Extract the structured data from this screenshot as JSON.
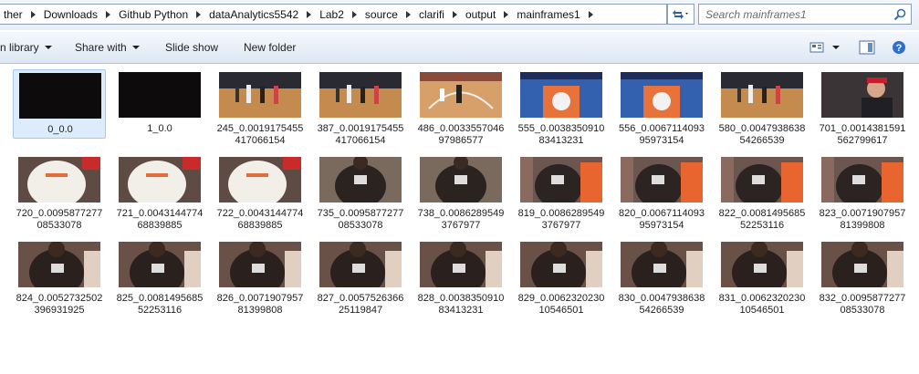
{
  "address": {
    "crumbs": [
      "ther",
      "Downloads",
      "Github Python",
      "dataAnalytics5542",
      "Lab2",
      "source",
      "clarifi",
      "output",
      "mainframes1"
    ]
  },
  "search": {
    "placeholder": "Search mainframes1"
  },
  "toolbar": {
    "include_label": "n library",
    "share_label": "Share with",
    "slideshow_label": "Slide show",
    "newfolder_label": "New folder"
  },
  "files": [
    {
      "line1": "0_0.0",
      "line2": "",
      "thumb": "dark"
    },
    {
      "line1": "1_0.0",
      "line2": "",
      "thumb": "dark"
    },
    {
      "line1": "245_0.0019175455",
      "line2": "417066154",
      "thumb": "court-wide"
    },
    {
      "line1": "387_0.0019175455",
      "line2": "417066154",
      "thumb": "court-wide"
    },
    {
      "line1": "486_0.0033557046",
      "line2": "97986577",
      "thumb": "court-player"
    },
    {
      "line1": "555_0.0038350910",
      "line2": "83413231",
      "thumb": "court-logo"
    },
    {
      "line1": "556_0.0067114093",
      "line2": "95973154",
      "thumb": "court-logo"
    },
    {
      "line1": "580_0.0047938638",
      "line2": "54266539",
      "thumb": "court-wide"
    },
    {
      "line1": "701_0.0014381591",
      "line2": "562799617",
      "thumb": "person"
    },
    {
      "line1": "720_0.0095877277",
      "line2": "08533078",
      "thumb": "white-jersey"
    },
    {
      "line1": "721_0.0043144774",
      "line2": "68839885",
      "thumb": "white-jersey"
    },
    {
      "line1": "722_0.0043144774",
      "line2": "68839885",
      "thumb": "white-jersey"
    },
    {
      "line1": "735_0.0095877277",
      "line2": "08533078",
      "thumb": "black-jersey"
    },
    {
      "line1": "738_0.0086289549",
      "line2": "3767977",
      "thumb": "black-jersey"
    },
    {
      "line1": "819_0.0086289549",
      "line2": "3767977",
      "thumb": "mixed"
    },
    {
      "line1": "820_0.0067114093",
      "line2": "95973154",
      "thumb": "mixed"
    },
    {
      "line1": "822_0.0081495685",
      "line2": "52253116",
      "thumb": "mixed"
    },
    {
      "line1": "823_0.0071907957",
      "line2": "81399808",
      "thumb": "mixed"
    },
    {
      "line1": "824_0.0052732502",
      "line2": "396931925",
      "thumb": "black-close"
    },
    {
      "line1": "825_0.0081495685",
      "line2": "52253116",
      "thumb": "black-close"
    },
    {
      "line1": "826_0.0071907957",
      "line2": "81399808",
      "thumb": "black-close"
    },
    {
      "line1": "827_0.0057526366",
      "line2": "25119847",
      "thumb": "black-close"
    },
    {
      "line1": "828_0.0038350910",
      "line2": "83413231",
      "thumb": "black-close"
    },
    {
      "line1": "829_0.0062320230",
      "line2": "10546501",
      "thumb": "black-close"
    },
    {
      "line1": "830_0.0047938638",
      "line2": "54266539",
      "thumb": "black-close"
    },
    {
      "line1": "831_0.0062320230",
      "line2": "10546501",
      "thumb": "black-close"
    },
    {
      "line1": "832_0.0095877277",
      "line2": "08533078",
      "thumb": "black-close"
    }
  ]
}
